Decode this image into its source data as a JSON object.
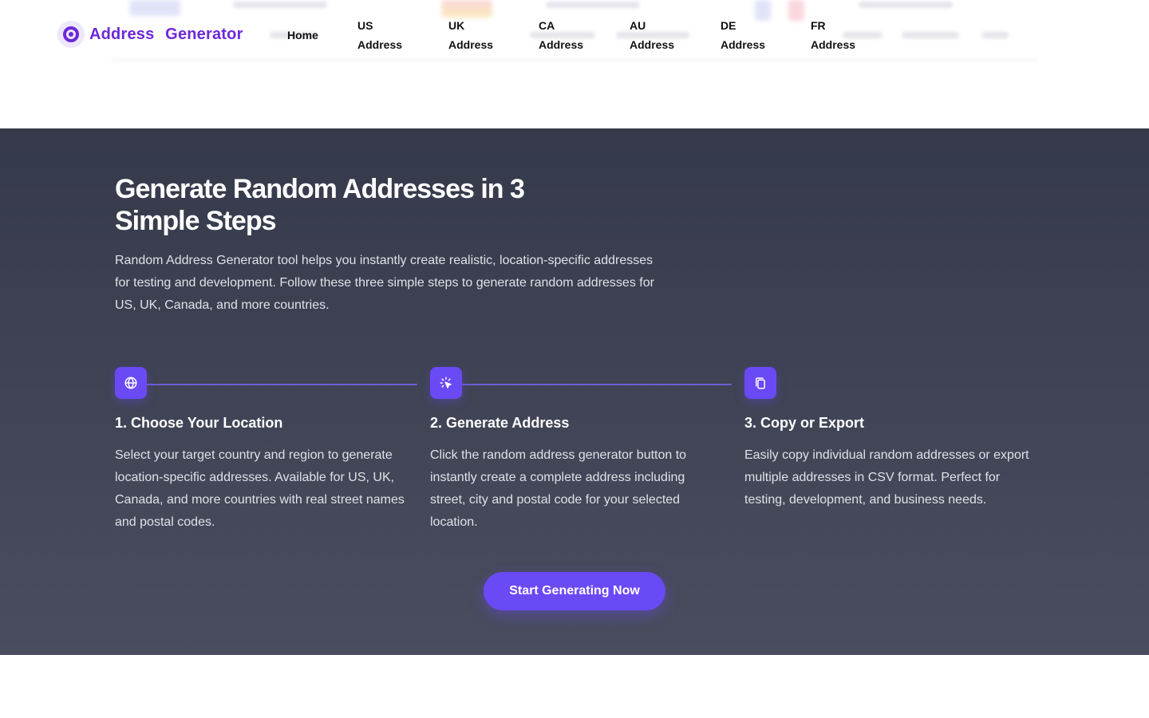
{
  "header": {
    "logo_text": "Address Generator",
    "nav": [
      {
        "label": "Home"
      },
      {
        "label": "US Address"
      },
      {
        "label": "UK Address"
      },
      {
        "label": "CA Address"
      },
      {
        "label": "AU Address"
      },
      {
        "label": "DE Address"
      },
      {
        "label": "FR Address"
      }
    ]
  },
  "steps_section": {
    "title": "Generate Random Addresses in 3 Simple Steps",
    "intro": "Random Address Generator tool helps you instantly create realistic, location-specific addresses for testing and development. Follow these three simple steps to generate random addresses for US, UK, Canada, and more countries.",
    "steps": [
      {
        "icon": "globe-icon",
        "title": "1. Choose Your Location",
        "description": "Select your target country and region to generate location-specific addresses. Available for US, UK, Canada, and more countries with real street names and postal codes."
      },
      {
        "icon": "cursor-click-icon",
        "title": "2. Generate Address",
        "description": "Click the random address generator button to instantly create a complete address including street, city and postal code for your selected location."
      },
      {
        "icon": "copy-icon",
        "title": "3. Copy or Export",
        "description": "Easily copy individual random addresses or export multiple addresses in CSV format. Perfect for testing, development, and business needs."
      }
    ],
    "cta_label": "Start Generating Now"
  },
  "colors": {
    "brand": "#6d28d9",
    "accent": "#6a4af5",
    "section_bg_top": "#353a4b",
    "section_bg_bottom": "#4a4d5e"
  }
}
